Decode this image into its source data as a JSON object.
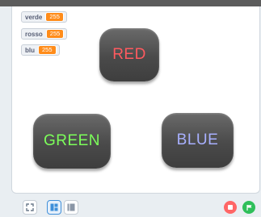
{
  "monitors": [
    {
      "label": "verde",
      "value": "255"
    },
    {
      "label": "rosso",
      "value": "255"
    },
    {
      "label": "blu",
      "value": "255"
    }
  ],
  "buttons": {
    "red": {
      "label": "RED",
      "color": "#ff5a5f"
    },
    "green": {
      "label": "GREEN",
      "color": "#7cff5a"
    },
    "blue": {
      "label": "BLUE",
      "color": "#a8b0ff"
    }
  },
  "toolbar": {
    "fullscreen_icon": "fullscreen-icon",
    "small_stage_icon": "small-stage-icon",
    "large_stage_icon": "large-stage-icon",
    "stop_icon": "stop-icon",
    "green_flag_icon": "green-flag-icon"
  },
  "colors": {
    "monitor_value_bg": "#ff8c1a",
    "stop": "#ff6666",
    "green_flag": "#2fbf5a",
    "accent": "#3f8fd9"
  }
}
